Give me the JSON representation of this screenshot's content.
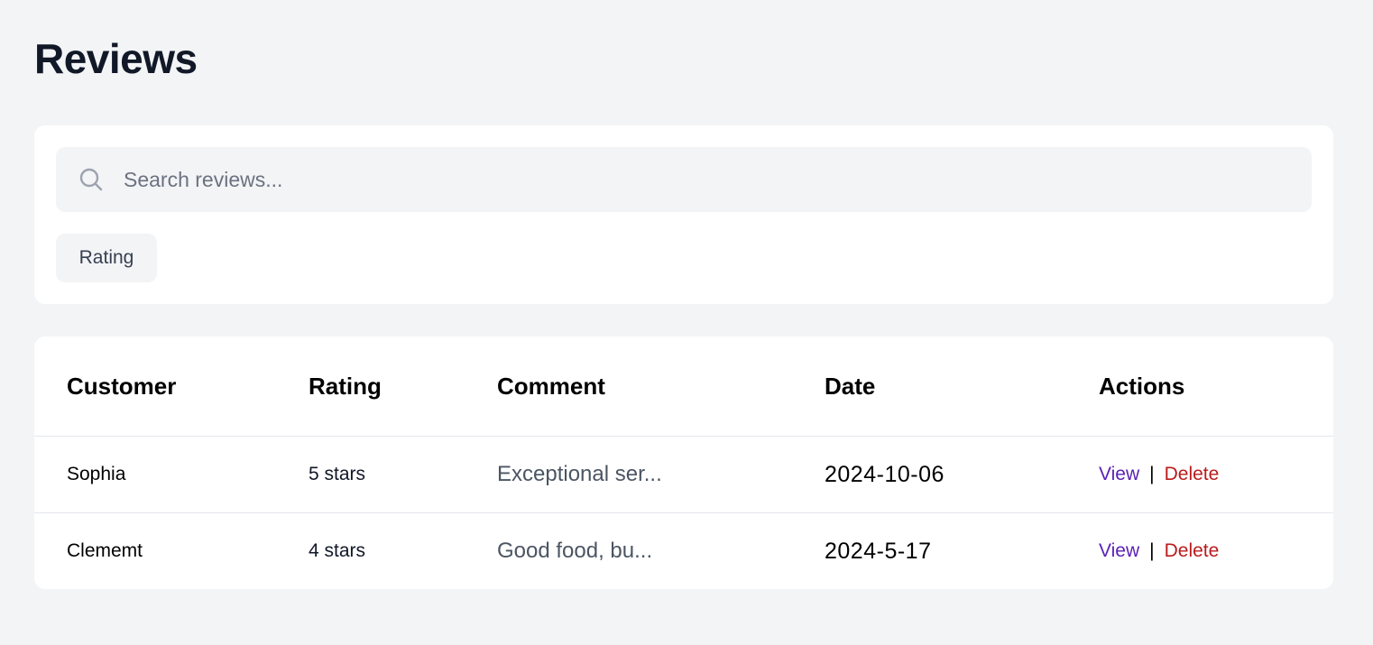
{
  "page": {
    "title": "Reviews"
  },
  "search": {
    "placeholder": "Search reviews...",
    "value": ""
  },
  "filters": {
    "rating_label": "Rating"
  },
  "table": {
    "headers": {
      "customer": "Customer",
      "rating": "Rating",
      "comment": "Comment",
      "date": "Date",
      "actions": "Actions"
    },
    "rows": [
      {
        "customer": "Sophia",
        "rating": "5 stars",
        "comment": "Exceptional ser...",
        "date": "2024-10-06",
        "view_label": "View",
        "separator": "|",
        "delete_label": "Delete"
      },
      {
        "customer": "Clememt",
        "rating": "4 stars",
        "comment": "Good food, bu...",
        "date": "2024-5-17",
        "view_label": "View",
        "separator": "|",
        "delete_label": "Delete"
      }
    ]
  },
  "colors": {
    "background": "#f3f4f6",
    "card": "#ffffff",
    "view_link": "#5b21b6",
    "delete_link": "#b91c1c"
  },
  "icons": {
    "search": "search-icon"
  }
}
